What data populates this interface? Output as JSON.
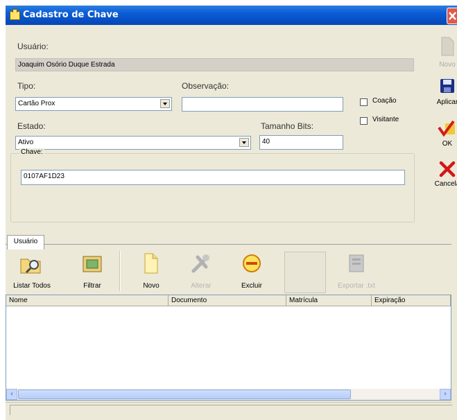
{
  "window": {
    "title": "Cadastro de Chave"
  },
  "form": {
    "usuario_label": "Usuário:",
    "usuario_value": "Joaquim Osório Duque Estrada",
    "tipo_label": "Tipo:",
    "tipo_value": "Cartão Prox",
    "observacao_label": "Observação:",
    "observacao_value": "",
    "estado_label": "Estado:",
    "estado_value": "Ativo",
    "tamanho_label": "Tamanho Bits:",
    "tamanho_value": "40",
    "coacao_label": "Coação",
    "visitante_label": "Visitante",
    "chave_label": "Chave:",
    "chave_value": "0107AF1D23"
  },
  "side_buttons": {
    "novo": "Novo",
    "aplicar": "Aplicar",
    "ok": "OK",
    "cancelar": "Cancela"
  },
  "tabs": {
    "usuario": "Usuário"
  },
  "toolbar": {
    "listar_todos": "Listar Todos",
    "filtrar": "Filtrar",
    "novo": "Novo",
    "alterar": "Alterar",
    "excluir": "Excluir",
    "exportar": "Exportar .txt"
  },
  "grid": {
    "columns": [
      "Nome",
      "Documento",
      "Matrícula",
      "Expiração"
    ]
  }
}
